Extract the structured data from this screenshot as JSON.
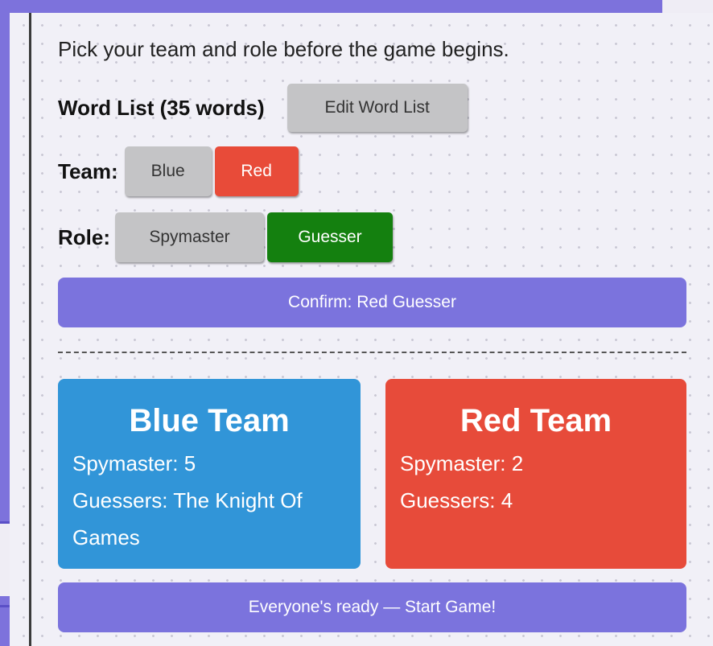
{
  "instructions": "Pick your team and role before the game begins.",
  "word_list": {
    "label": "Word List (35 words)",
    "edit_button": "Edit Word List"
  },
  "team": {
    "label": "Team:",
    "options": [
      "Blue",
      "Red"
    ],
    "selected": "Red"
  },
  "role": {
    "label": "Role:",
    "options": [
      "Spymaster",
      "Guesser"
    ],
    "selected": "Guesser"
  },
  "confirm_button": "Confirm: Red Guesser",
  "teams": {
    "blue": {
      "title": "Blue Team",
      "spymaster": "Spymaster: 5",
      "guessers": "Guessers: The Knight Of Games"
    },
    "red": {
      "title": "Red Team",
      "spymaster": "Spymaster: 2",
      "guessers": "Guessers: 4"
    }
  },
  "start_button": "Everyone's ready — Start Game!",
  "colors": {
    "accent": "#7b73dd",
    "blue_team": "#3195d8",
    "red_team": "#e74b3a",
    "selected_team": "#e84b39",
    "selected_role": "#14800f",
    "unselected": "#c4c4c6"
  }
}
